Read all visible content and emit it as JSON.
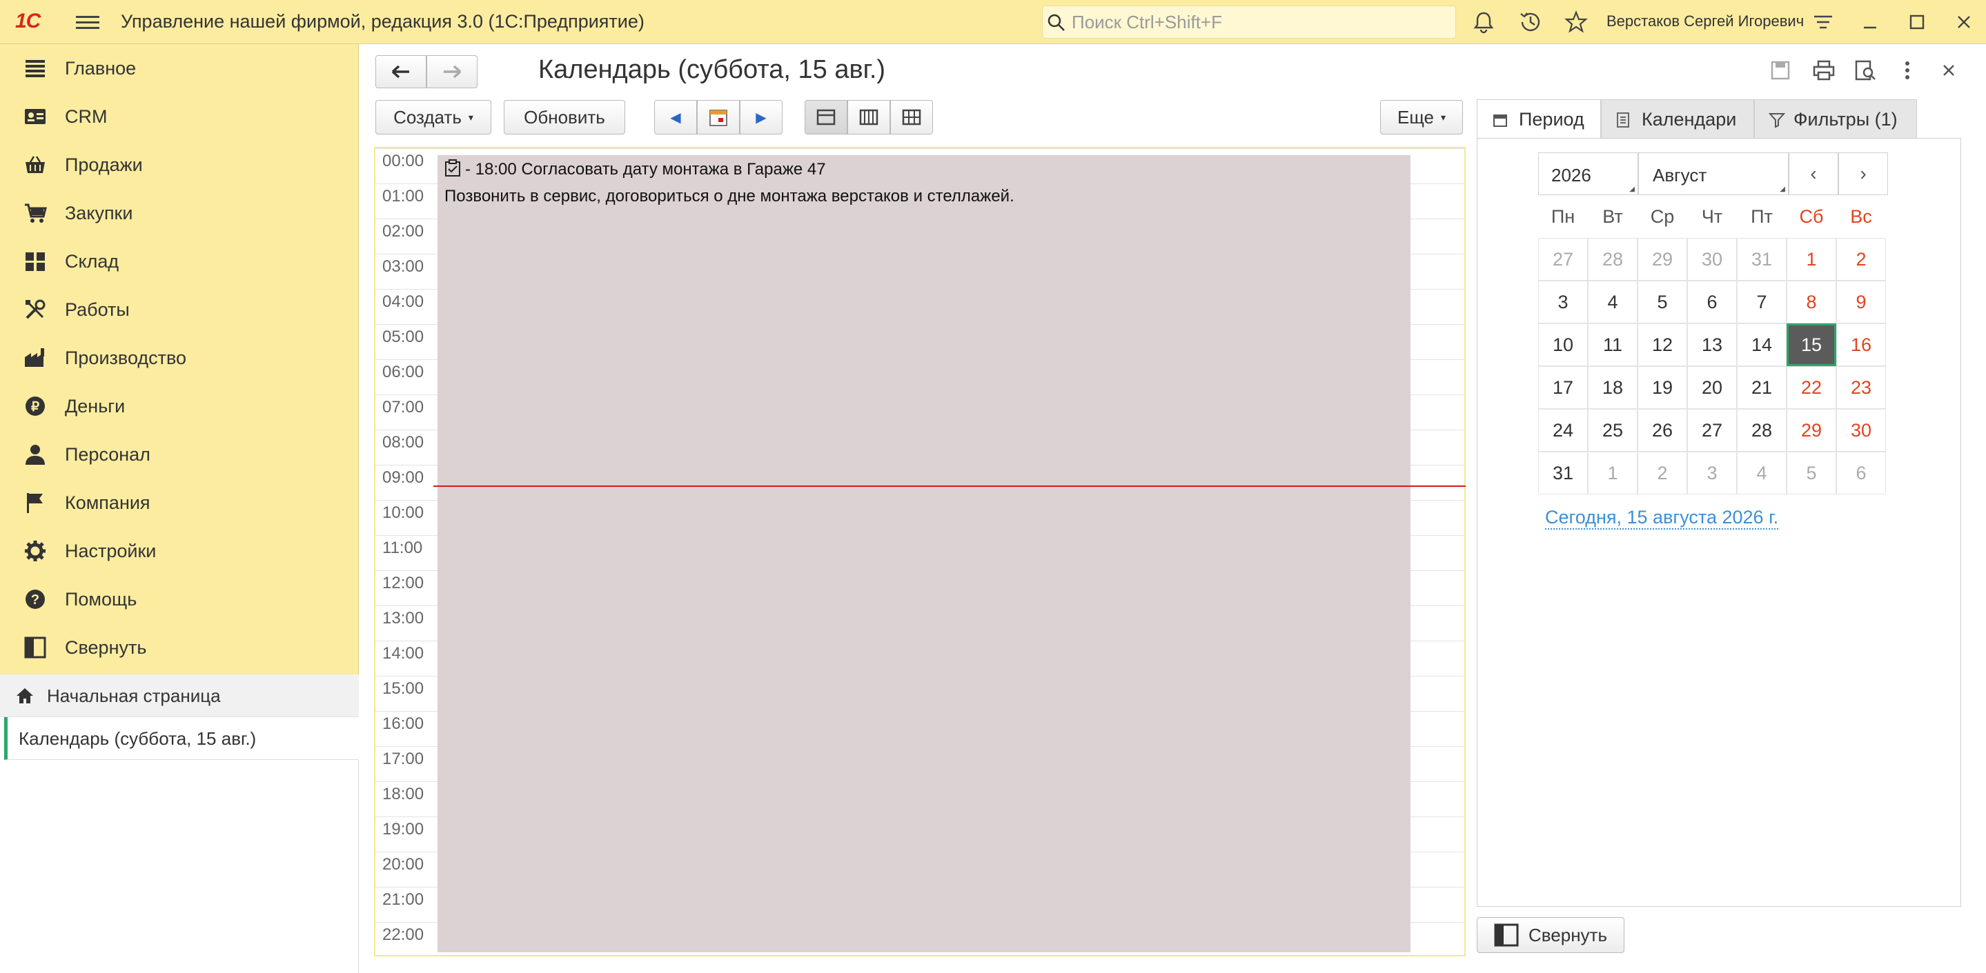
{
  "app": {
    "logo": "1С",
    "title": "Управление нашей фирмой, редакция 3.0  (1С:Предприятие)",
    "search_placeholder": "Поиск Ctrl+Shift+F",
    "user": "Верстаков Сергей Игоревич"
  },
  "sidebar": {
    "items": [
      {
        "label": "Главное",
        "icon": "menu-lines-icon"
      },
      {
        "label": "CRM",
        "icon": "contact-card-icon"
      },
      {
        "label": "Продажи",
        "icon": "shopping-basket-icon"
      },
      {
        "label": "Закупки",
        "icon": "shopping-cart-icon"
      },
      {
        "label": "Склад",
        "icon": "warehouse-grid-icon"
      },
      {
        "label": "Работы",
        "icon": "tools-icon"
      },
      {
        "label": "Производство",
        "icon": "factory-icon"
      },
      {
        "label": "Деньги",
        "icon": "ruble-coin-icon"
      },
      {
        "label": "Персонал",
        "icon": "person-icon"
      },
      {
        "label": "Компания",
        "icon": "flag-icon"
      },
      {
        "label": "Настройки",
        "icon": "gear-icon"
      },
      {
        "label": "Помощь",
        "icon": "help-circle-icon"
      },
      {
        "label": "Свернуть",
        "icon": "collapse-panel-icon"
      }
    ],
    "open_windows": {
      "home": "Начальная страница",
      "active": "Календарь (суббота, 15 авг.)"
    }
  },
  "page": {
    "title": "Календарь (суббота, 15 авг.)"
  },
  "toolbar": {
    "create": "Создать",
    "refresh": "Обновить",
    "more": "Еще"
  },
  "schedule": {
    "hours": [
      "00:00",
      "01:00",
      "02:00",
      "03:00",
      "04:00",
      "05:00",
      "06:00",
      "07:00",
      "08:00",
      "09:00",
      "10:00",
      "11:00",
      "12:00",
      "13:00",
      "14:00",
      "15:00",
      "16:00",
      "17:00",
      "18:00",
      "19:00",
      "20:00",
      "21:00",
      "22:00"
    ],
    "event": {
      "title": "- 18:00 Согласовать дату монтажа в Гараже 47",
      "description": "Позвонить в сервис, договориться о дне монтажа верстаков и стеллажей."
    },
    "current_time_line": "09:00"
  },
  "panel": {
    "tabs": [
      "Период",
      "Календари",
      "Фильтры (1)"
    ],
    "year": "2026",
    "month": "Август",
    "weekdays": [
      "Пн",
      "Вт",
      "Ср",
      "Чт",
      "Пт",
      "Сб",
      "Вс"
    ],
    "weeks": [
      [
        "27",
        "28",
        "29",
        "30",
        "31",
        "1",
        "2"
      ],
      [
        "3",
        "4",
        "5",
        "6",
        "7",
        "8",
        "9"
      ],
      [
        "10",
        "11",
        "12",
        "13",
        "14",
        "15",
        "16"
      ],
      [
        "17",
        "18",
        "19",
        "20",
        "21",
        "22",
        "23"
      ],
      [
        "24",
        "25",
        "26",
        "27",
        "28",
        "29",
        "30"
      ],
      [
        "31",
        "1",
        "2",
        "3",
        "4",
        "5",
        "6"
      ]
    ],
    "selected_day": "15",
    "today_link": "Сегодня, 15 августа 2026 г.",
    "collapse": "Свернуть"
  },
  "colors": {
    "accent": "#fbeca0",
    "weekend": "#e0451e",
    "selected": "#5b5b5b",
    "selected_border": "#2da66b",
    "event_bg": "#dcd1d3",
    "now_line": "#d41b1b",
    "link": "#3d8fd6"
  }
}
